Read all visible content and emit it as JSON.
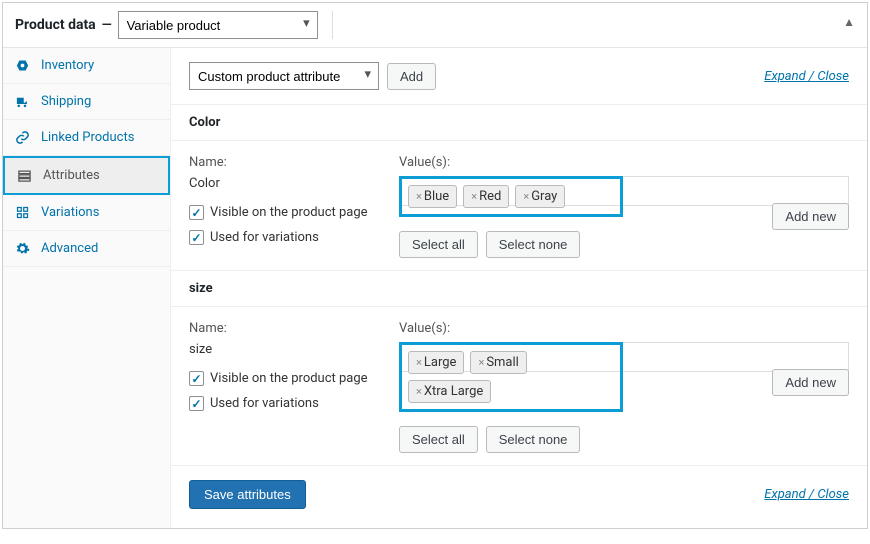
{
  "header": {
    "title": "Product data",
    "product_type": "Variable product"
  },
  "sidebar": {
    "items": [
      {
        "label": "Inventory"
      },
      {
        "label": "Shipping"
      },
      {
        "label": "Linked Products"
      },
      {
        "label": "Attributes"
      },
      {
        "label": "Variations"
      },
      {
        "label": "Advanced"
      }
    ]
  },
  "top": {
    "attribute_type_select": "Custom product attribute",
    "add_label": "Add",
    "expand_close": "Expand / Close"
  },
  "attributes": [
    {
      "heading": "Color",
      "name_label": "Name:",
      "name_value": "Color",
      "visible_label": "Visible on the product page",
      "variations_label": "Used for variations",
      "values_label": "Value(s):",
      "tags": [
        "Blue",
        "Red",
        "Gray"
      ],
      "select_all": "Select all",
      "select_none": "Select none",
      "add_new": "Add new"
    },
    {
      "heading": "size",
      "name_label": "Name:",
      "name_value": "size",
      "visible_label": "Visible on the product page",
      "variations_label": "Used for variations",
      "values_label": "Value(s):",
      "tags": [
        "Large",
        "Small",
        "Xtra Large"
      ],
      "select_all": "Select all",
      "select_none": "Select none",
      "add_new": "Add new"
    }
  ],
  "bottom": {
    "save_label": "Save attributes",
    "expand_close": "Expand / Close"
  }
}
